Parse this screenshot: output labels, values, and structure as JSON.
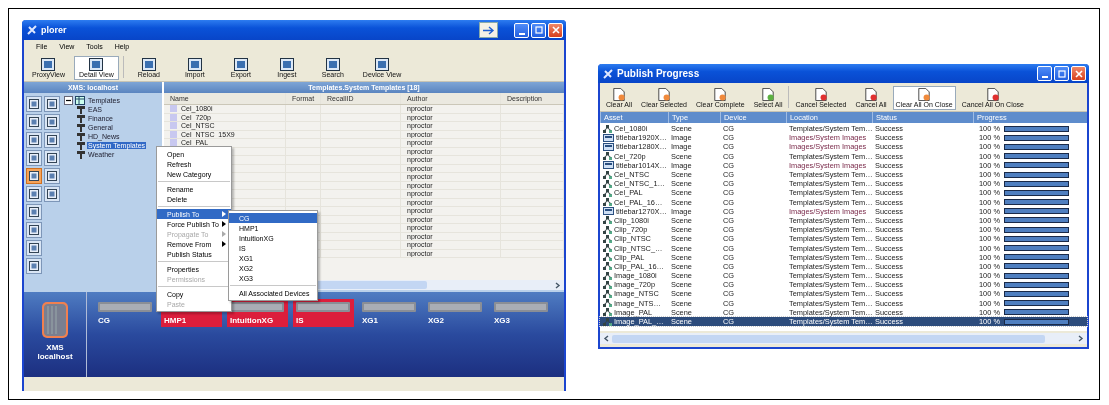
{
  "explorer": {
    "title": "plorer",
    "menu": [
      "File",
      "View",
      "Tools",
      "Help"
    ],
    "toolbar": [
      {
        "label": "ProxyView",
        "selected": false
      },
      {
        "label": "Detail View",
        "selected": true
      },
      {
        "label": "Reload",
        "selected": false
      },
      {
        "label": "Import",
        "selected": false
      },
      {
        "label": "Export",
        "selected": false
      },
      {
        "label": "Ingest",
        "selected": false
      },
      {
        "label": "Search",
        "selected": false
      },
      {
        "label": "Device View",
        "selected": false
      }
    ],
    "left_panel": {
      "title": "XMS: localhost",
      "side_tools": [
        {
          "selected": false
        },
        {
          "selected": false
        },
        {
          "selected": false
        },
        {
          "selected": false
        },
        {
          "selected": false
        },
        {
          "selected": false
        },
        {
          "selected": false
        },
        {
          "selected": false
        },
        {
          "selected": true
        },
        {
          "selected": false
        },
        {
          "selected": false
        },
        {
          "selected": false
        },
        {
          "selected": false
        },
        {
          "selected": false
        },
        {
          "selected": false
        },
        {
          "selected": false
        }
      ],
      "tree": [
        {
          "label": "Templates",
          "expanded": true,
          "selected": false,
          "children": [
            {
              "label": "EAS",
              "selected": false
            },
            {
              "label": "Finance",
              "selected": false
            },
            {
              "label": "General",
              "selected": false
            },
            {
              "label": "HD_News",
              "selected": false
            },
            {
              "label": "System Templates",
              "selected": true
            },
            {
              "label": "Weather",
              "selected": false
            }
          ]
        }
      ]
    },
    "table": {
      "title": "Templates.System Templates [18]",
      "columns": [
        "Name",
        "Format",
        "RecallID",
        "Author",
        "Description"
      ],
      "rows": [
        {
          "name": "Cel_1080i",
          "author": "nproctor"
        },
        {
          "name": "Cel_720p",
          "author": "nproctor"
        },
        {
          "name": "Cel_NTSC",
          "author": "nproctor"
        },
        {
          "name": "Cel_NTSC_15X9",
          "author": "nproctor"
        },
        {
          "name": "Cel_PAL",
          "author": "nproctor"
        },
        {
          "author": "nproctor"
        },
        {
          "author": "nproctor"
        },
        {
          "author": "nproctor"
        },
        {
          "author": "nproctor"
        },
        {
          "author": "nproctor"
        },
        {
          "author": "nproctor"
        },
        {
          "author": "nproctor"
        },
        {
          "author": "nproctor"
        },
        {
          "author": "nproctor"
        },
        {
          "author": "nproctor"
        },
        {
          "author": "nproctor"
        },
        {
          "author": "nproctor"
        },
        {
          "author": "nproctor"
        }
      ]
    },
    "context_menu": [
      {
        "kind": "item",
        "label": "Open",
        "disabled": false,
        "selected": false,
        "submenu": false
      },
      {
        "kind": "item",
        "label": "Refresh",
        "disabled": false,
        "selected": false,
        "submenu": false
      },
      {
        "kind": "item",
        "label": "New Category",
        "disabled": false,
        "selected": false,
        "submenu": false
      },
      {
        "kind": "separator"
      },
      {
        "kind": "item",
        "label": "Rename",
        "disabled": false,
        "selected": false,
        "submenu": false
      },
      {
        "kind": "item",
        "label": "Delete",
        "disabled": false,
        "selected": false,
        "submenu": false
      },
      {
        "kind": "separator"
      },
      {
        "kind": "item",
        "label": "Publish To",
        "disabled": false,
        "selected": true,
        "submenu": true
      },
      {
        "kind": "item",
        "label": "Force Publish To",
        "disabled": false,
        "selected": false,
        "submenu": true
      },
      {
        "kind": "item",
        "label": "Propagate To",
        "disabled": true,
        "selected": false,
        "submenu": true
      },
      {
        "kind": "item",
        "label": "Remove From",
        "disabled": false,
        "selected": false,
        "submenu": true
      },
      {
        "kind": "item",
        "label": "Publish Status",
        "disabled": false,
        "selected": false,
        "submenu": false
      },
      {
        "kind": "separator"
      },
      {
        "kind": "item",
        "label": "Properties",
        "disabled": false,
        "selected": false,
        "submenu": false
      },
      {
        "kind": "item",
        "label": "Permissions",
        "disabled": true,
        "selected": false,
        "submenu": false
      },
      {
        "kind": "separator"
      },
      {
        "kind": "item",
        "label": "Copy",
        "disabled": false,
        "selected": false,
        "submenu": false
      },
      {
        "kind": "item",
        "label": "Paste",
        "disabled": true,
        "selected": false,
        "submenu": false
      }
    ],
    "submenu": [
      {
        "kind": "item",
        "label": "CG",
        "selected": true
      },
      {
        "kind": "item",
        "label": "HMP1",
        "selected": false
      },
      {
        "kind": "item",
        "label": "IntuitionXG",
        "selected": false
      },
      {
        "kind": "item",
        "label": "IS",
        "selected": false
      },
      {
        "kind": "item",
        "label": "XG1",
        "selected": false
      },
      {
        "kind": "item",
        "label": "XG2",
        "selected": false
      },
      {
        "kind": "item",
        "label": "XG3",
        "selected": false
      },
      {
        "kind": "separator"
      },
      {
        "kind": "item",
        "label": "All Associated Devices",
        "selected": false
      }
    ],
    "server": {
      "label": "XMS\nlocalhost"
    },
    "devices": [
      {
        "label": "CG",
        "highlighted": false
      },
      {
        "label": "HMP1",
        "highlighted": true
      },
      {
        "label": "IntuitionXG",
        "highlighted": true
      },
      {
        "label": "IS",
        "highlighted": true
      },
      {
        "label": "XG1",
        "highlighted": false
      },
      {
        "label": "XG2",
        "highlighted": false
      },
      {
        "label": "XG3",
        "highlighted": false
      }
    ]
  },
  "publish_progress": {
    "title": "Publish Progress",
    "toolbar": [
      {
        "label": "Clear All",
        "selected": false,
        "color": "#f08a3c"
      },
      {
        "label": "Clear Selected",
        "selected": false,
        "color": "#f08a3c"
      },
      {
        "label": "Clear Complete",
        "selected": false,
        "color": "#f08a3c"
      },
      {
        "label": "Select All",
        "selected": false,
        "color": "#5cb040"
      },
      {
        "label": "Cancel Selected",
        "selected": false,
        "color": "#e03030"
      },
      {
        "label": "Cancel All",
        "selected": false,
        "color": "#e03030"
      },
      {
        "label": "Clear All On Close",
        "selected": true,
        "color": "#f08a3c"
      },
      {
        "label": "Cancel All On Close",
        "selected": false,
        "color": "#e03030"
      }
    ],
    "columns": [
      "Asset",
      "Type",
      "Device",
      "Location",
      "Status",
      "Progress"
    ],
    "rows": [
      {
        "kind": "scene",
        "asset": "Cel_1080i",
        "type": "Scene",
        "device": "CG",
        "location": "Templates/System Tem…",
        "status": "Success",
        "percent": "100 %",
        "level": 1,
        "selected": false
      },
      {
        "kind": "image",
        "asset": "titlebar1920X…",
        "type": "Image",
        "device": "CG",
        "location": "Images/System Images",
        "status": "Success",
        "percent": "100 %",
        "level": 1,
        "selected": false
      },
      {
        "kind": "image",
        "asset": "titlebar1280X…",
        "type": "Image",
        "device": "CG",
        "location": "Images/System Images",
        "status": "Success",
        "percent": "100 %",
        "level": 1,
        "selected": false
      },
      {
        "kind": "scene",
        "asset": "Cel_720p",
        "type": "Scene",
        "device": "CG",
        "location": "Templates/System Tem…",
        "status": "Success",
        "percent": "100 %",
        "level": 1,
        "selected": false
      },
      {
        "kind": "image",
        "asset": "titlebar1014X…",
        "type": "Image",
        "device": "CG",
        "location": "Images/System Images",
        "status": "Success",
        "percent": "100 %",
        "level": 1,
        "selected": false
      },
      {
        "kind": "scene",
        "asset": "Cel_NTSC",
        "type": "Scene",
        "device": "CG",
        "location": "Templates/System Tem…",
        "status": "Success",
        "percent": "100 %",
        "level": 1,
        "selected": false
      },
      {
        "kind": "scene",
        "asset": "Cel_NTSC_1…",
        "type": "Scene",
        "device": "CG",
        "location": "Templates/System Tem…",
        "status": "Success",
        "percent": "100 %",
        "level": 1,
        "selected": false
      },
      {
        "kind": "scene",
        "asset": "Cel_PAL",
        "type": "Scene",
        "device": "CG",
        "location": "Templates/System Tem…",
        "status": "Success",
        "percent": "100 %",
        "level": 1,
        "selected": false
      },
      {
        "kind": "scene",
        "asset": "Cel_PAL_16…",
        "type": "Scene",
        "device": "CG",
        "location": "Templates/System Tem…",
        "status": "Success",
        "percent": "100 %",
        "level": 1,
        "selected": false
      },
      {
        "kind": "image",
        "asset": "titlebar1270X…",
        "type": "Image",
        "device": "CG",
        "location": "Images/System Images",
        "status": "Success",
        "percent": "100 %",
        "level": 1,
        "selected": false
      },
      {
        "kind": "scene",
        "asset": "Clip_1080i",
        "type": "Scene",
        "device": "CG",
        "location": "Templates/System Tem…",
        "status": "Success",
        "percent": "100 %",
        "level": 1,
        "selected": false
      },
      {
        "kind": "scene",
        "asset": "Clip_720p",
        "type": "Scene",
        "device": "CG",
        "location": "Templates/System Tem…",
        "status": "Success",
        "percent": "100 %",
        "level": 1,
        "selected": false
      },
      {
        "kind": "scene",
        "asset": "Clip_NTSC",
        "type": "Scene",
        "device": "CG",
        "location": "Templates/System Tem…",
        "status": "Success",
        "percent": "100 %",
        "level": 1,
        "selected": false
      },
      {
        "kind": "scene",
        "asset": "Clip_NTSC_…",
        "type": "Scene",
        "device": "CG",
        "location": "Templates/System Tem…",
        "status": "Success",
        "percent": "100 %",
        "level": 1,
        "selected": false
      },
      {
        "kind": "scene",
        "asset": "Clip_PAL",
        "type": "Scene",
        "device": "CG",
        "location": "Templates/System Tem…",
        "status": "Success",
        "percent": "100 %",
        "level": 1,
        "selected": false
      },
      {
        "kind": "scene",
        "asset": "Clip_PAL_16…",
        "type": "Scene",
        "device": "CG",
        "location": "Templates/System Tem…",
        "status": "Success",
        "percent": "100 %",
        "level": 1,
        "selected": false
      },
      {
        "kind": "scene",
        "asset": "Image_1080i",
        "type": "Scene",
        "device": "CG",
        "location": "Templates/System Tem…",
        "status": "Success",
        "percent": "100 %",
        "level": 1,
        "selected": false
      },
      {
        "kind": "scene",
        "asset": "Image_720p",
        "type": "Scene",
        "device": "CG",
        "location": "Templates/System Tem…",
        "status": "Success",
        "percent": "100 %",
        "level": 1,
        "selected": false
      },
      {
        "kind": "scene",
        "asset": "Image_NTSC",
        "type": "Scene",
        "device": "CG",
        "location": "Templates/System Tem…",
        "status": "Success",
        "percent": "100 %",
        "level": 1,
        "selected": false
      },
      {
        "kind": "scene",
        "asset": "Image_NTS…",
        "type": "Scene",
        "device": "CG",
        "location": "Templates/System Tem…",
        "status": "Success",
        "percent": "100 %",
        "level": 1,
        "selected": false
      },
      {
        "kind": "scene",
        "asset": "Image_PAL",
        "type": "Scene",
        "device": "CG",
        "location": "Templates/System Tem…",
        "status": "Success",
        "percent": "100 %",
        "level": 1,
        "selected": false
      },
      {
        "kind": "scene",
        "asset": "Image_PAL_…",
        "type": "Scene",
        "device": "CG",
        "location": "Templates/System Tem…",
        "status": "Success",
        "percent": "100 %",
        "level": 1,
        "selected": true
      }
    ]
  }
}
